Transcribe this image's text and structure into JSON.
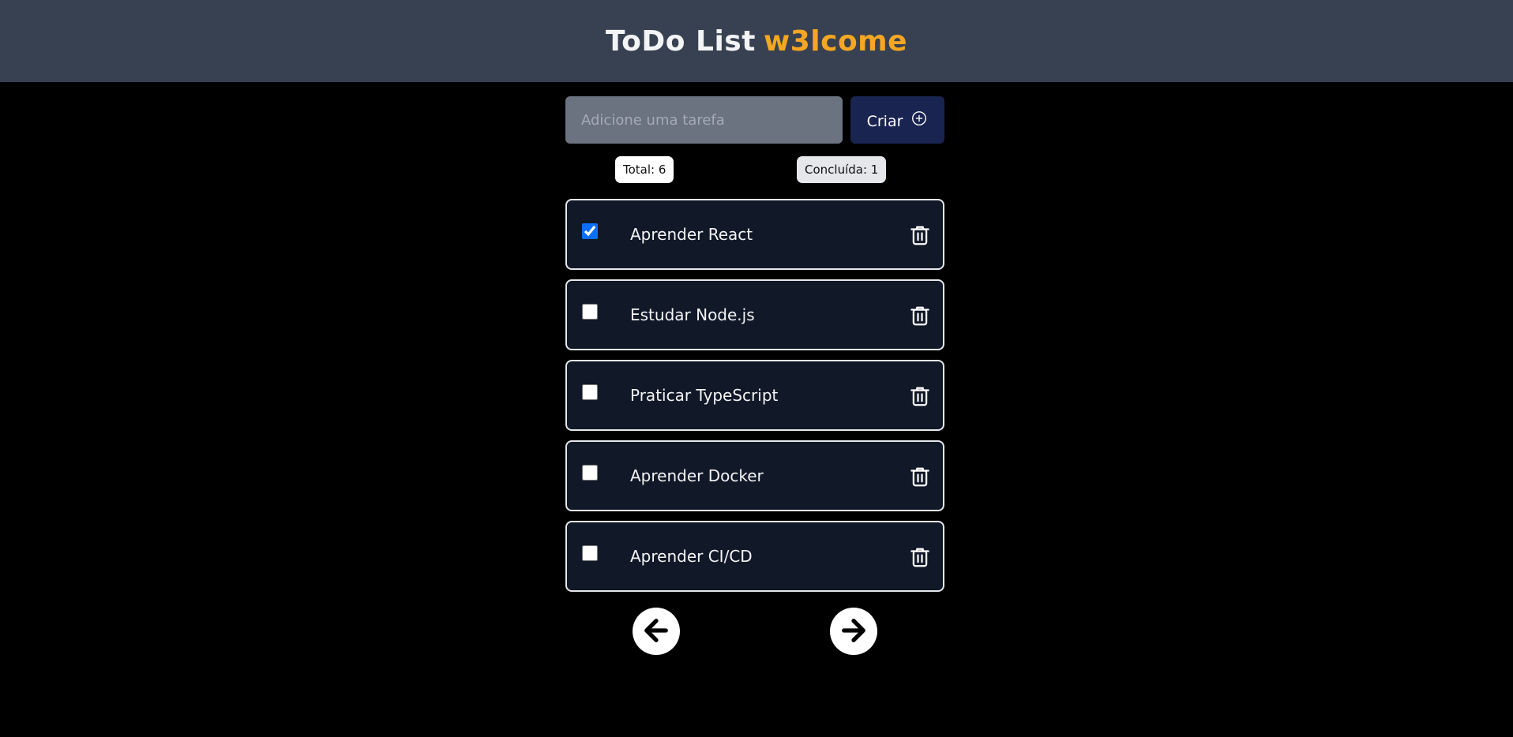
{
  "header": {
    "title": "ToDo List",
    "accent": "w3lcome",
    "accent_color": "#f5a623"
  },
  "new_task": {
    "placeholder": "Adicione uma tarefa",
    "value": "",
    "create_label": "Criar",
    "create_icon": "plus-circle-icon"
  },
  "counters": {
    "total": "Total: 6",
    "done": "Concluída: 1"
  },
  "tasks": [
    {
      "label": "Aprender React",
      "done": true
    },
    {
      "label": "Estudar Node.js",
      "done": false
    },
    {
      "label": "Praticar TypeScript",
      "done": false
    },
    {
      "label": "Aprender Docker",
      "done": false
    },
    {
      "label": "Aprender CI/CD",
      "done": false
    }
  ],
  "pager": {
    "prev_icon": "arrow-left-icon",
    "next_icon": "arrow-right-icon"
  }
}
